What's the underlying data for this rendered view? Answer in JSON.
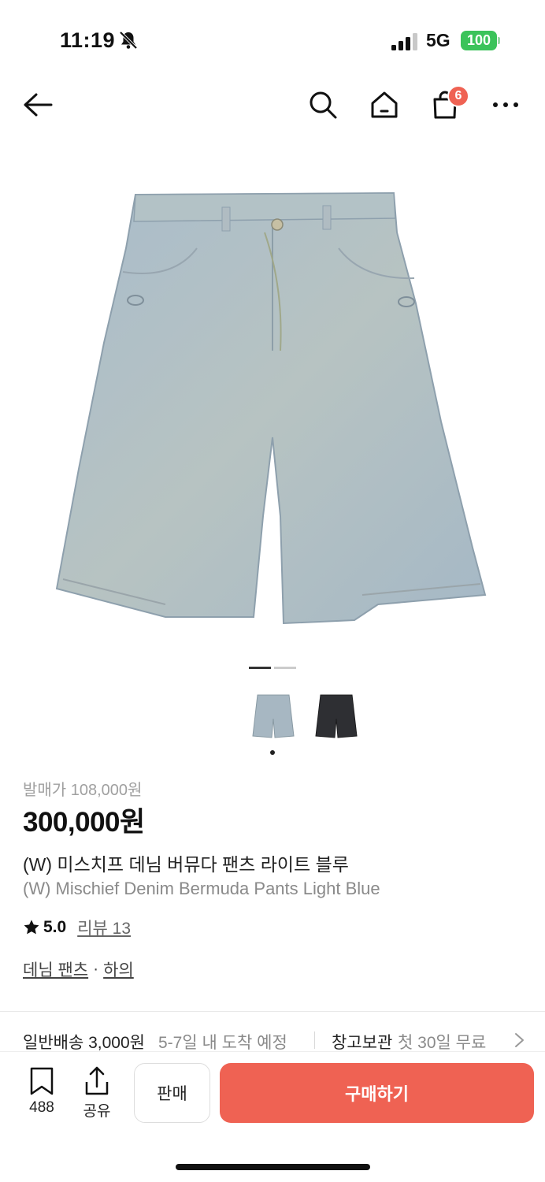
{
  "status_bar": {
    "time": "11:19",
    "network": "5G",
    "battery": "100"
  },
  "nav": {
    "cart_count": "6"
  },
  "gallery": {
    "thumbnails": [
      {
        "name": "light-blue-thumbnail",
        "color": "#a7b7c2"
      },
      {
        "name": "black-thumbnail",
        "color": "#2e2f33"
      }
    ],
    "active_index": 0
  },
  "product": {
    "release_price": "발매가 108,000원",
    "price": "300,000원",
    "name_ko": "(W) 미스치프 데님 버뮤다 팬츠 라이트 블루",
    "name_en": "(W) Mischief Denim Bermuda Pants Light Blue",
    "rating": "5.0",
    "review_label": "리뷰 13",
    "categories": [
      "데님 팬츠",
      "하의"
    ],
    "category_separator": "·"
  },
  "shipping": {
    "label": "일반배송 3,000원",
    "eta": "5-7일 내 도착 예정",
    "storage_label": "창고보관",
    "storage_note": "첫 30일 무료"
  },
  "bottom_bar": {
    "bookmark_count": "488",
    "share_label": "공유",
    "sell_label": "판매",
    "buy_label": "구매하기"
  },
  "colors": {
    "accent": "#ef6253",
    "battery": "#3bc35a"
  }
}
